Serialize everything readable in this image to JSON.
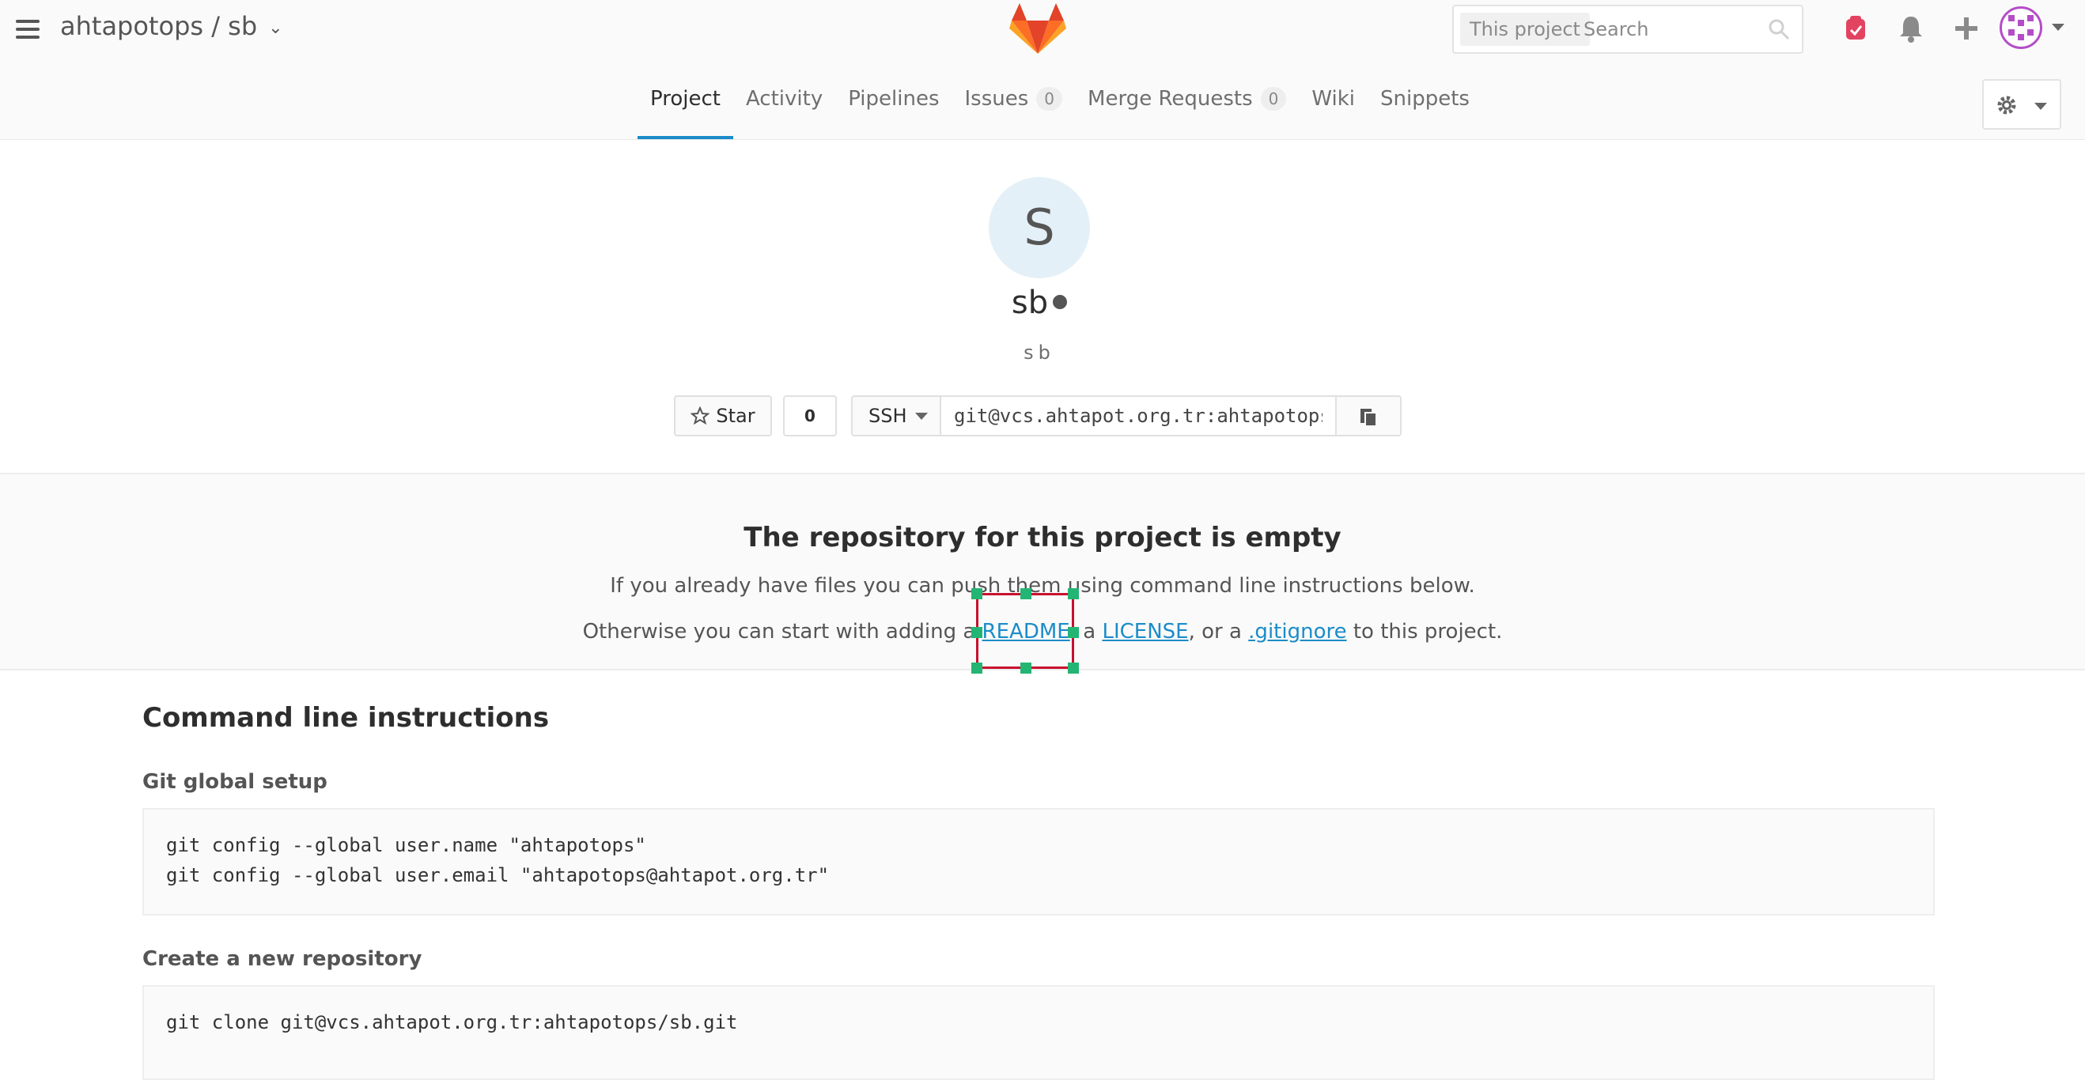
{
  "header": {
    "breadcrumb": "ahtapotops / sb",
    "search": {
      "scope": "This project",
      "placeholder": "Search"
    }
  },
  "nav": {
    "tabs": [
      {
        "label": "Project"
      },
      {
        "label": "Activity"
      },
      {
        "label": "Pipelines"
      },
      {
        "label": "Issues",
        "count": "0"
      },
      {
        "label": "Merge Requests",
        "count": "0"
      },
      {
        "label": "Wiki"
      },
      {
        "label": "Snippets"
      }
    ]
  },
  "project": {
    "avatar_letter": "S",
    "name": "sb",
    "description": "sb",
    "star_label": "Star",
    "star_count": "0",
    "protocol": "SSH",
    "clone_url": "git@vcs.ahtapot.org.tr:ahtapotops/sb.git"
  },
  "empty_repo": {
    "title": "The repository for this project is empty",
    "line1": "If you already have files you can push them using command line instructions below.",
    "line2_prefix": "Otherwise you can start with adding a",
    "readme": "README",
    "sep1": ", a",
    "license": "LICENSE",
    "sep2": ", or a",
    "gitignore": ".gitignore",
    "line2_suffix": "to this project."
  },
  "cli": {
    "title": "Command line instructions",
    "global_setup": {
      "title": "Git global setup",
      "code": "git config --global user.name \"ahtapotops\"\ngit config --global user.email \"ahtapotops@ahtapot.org.tr\""
    },
    "new_repo": {
      "title": "Create a new repository",
      "code": "git clone git@vcs.ahtapot.org.tr:ahtapotops/sb.git"
    }
  },
  "colors": {
    "accent": "#1b8cc9",
    "selection": "#c8102e",
    "handles": "#22b573"
  }
}
